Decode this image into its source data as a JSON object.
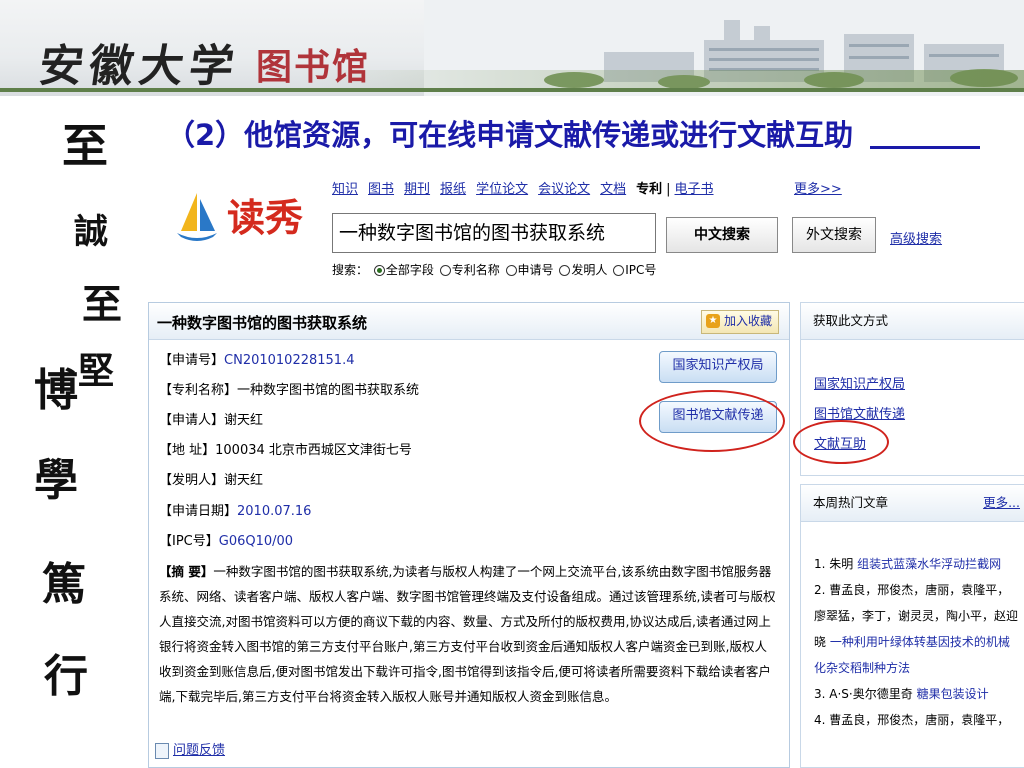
{
  "banner": {
    "calligraphy": "安徽大学",
    "library": "图书馆"
  },
  "motto": [
    "至",
    "誠",
    "至",
    "堅",
    "博",
    "學",
    "篤",
    "行"
  ],
  "slide_title": "（2）他馆资源，可在线申请文献传递或进行文献互助",
  "search": {
    "logo_text": "读秀",
    "nav": [
      "知识",
      "图书",
      "期刊",
      "报纸",
      "学位论文",
      "会议论文",
      "文档",
      "专利",
      "电子书",
      "更多>>"
    ],
    "current": "专利",
    "query": "一种数字图书馆的图书获取系统",
    "btn_cn": "中文搜索",
    "btn_foreign": "外文搜索",
    "advanced": "高级搜索",
    "options_label": "搜索：",
    "options": [
      "全部字段",
      "专利名称",
      "申请号",
      "发明人",
      "IPC号"
    ],
    "selected_option": "全部字段"
  },
  "record": {
    "title": "一种数字图书馆的图书获取系统",
    "fav": "加入收藏",
    "fields": [
      {
        "label": "【申请号】",
        "value": "CN201010228151.4"
      },
      {
        "label": "【专利名称】",
        "value": "一种数字图书馆的图书获取系统"
      },
      {
        "label": "【申请人】",
        "value": "谢天红"
      },
      {
        "label": "【地 址】",
        "value": "100034 北京市西城区文津街七号"
      },
      {
        "label": "【发明人】",
        "value": "谢天红"
      },
      {
        "label": "【申请日期】",
        "value": "2010.07.16"
      },
      {
        "label": "【IPC号】",
        "value": "G06Q10/00"
      }
    ],
    "abstract_label": "【摘 要】",
    "abstract": "一种数字图书馆的图书获取系统,为读者与版权人构建了一个网上交流平台,该系统由数字图书馆服务器系统、网络、读者客户端、版权人客户端、数字图书馆管理终端及支付设备组成。通过该管理系统,读者可与版权人直接交流,对图书馆资料可以方便的商议下载的内容、数量、方式及所付的版权费用,协议达成后,读者通过网上银行将资金转入图书馆的第三方支付平台账户,第三方支付平台收到资金后通知版权人客户端资金已到账,版权人收到资金到账信息后,便对图书馆发出下载许可指令,图书馆得到该指令后,便可将读者所需要资料下载给读者客户端,下载完毕后,第三方支付平台将资金转入版权人账号并通知版权人资金到账信息。",
    "btn_sipo": "国家知识产权局",
    "btn_delivery": "图书馆文献传递",
    "feedback": "问题反馈"
  },
  "acquire": {
    "head": "获取此文方式",
    "links": [
      "国家知识产权局",
      "图书馆文献传递",
      "文献互助"
    ]
  },
  "hot": {
    "head": "本周热门文章",
    "more": "更多...",
    "items": [
      {
        "num": "1.",
        "authors": "朱明",
        "title": "组装式蓝藻水华浮动拦截网"
      },
      {
        "num": "2.",
        "authors": "曹孟良，邢俊杰，唐丽，袁隆平，廖翠猛，李丁，谢灵灵，陶小平，赵迎晓",
        "title": "一种利用叶绿体转基因技术的机械化杂交稻制种方法"
      },
      {
        "num": "3.",
        "authors": "A·S·奥尔德里奇",
        "title": "糖果包装设计"
      },
      {
        "num": "4.",
        "authors": "曹孟良，邢俊杰，唐丽，袁隆平，",
        "title": ""
      }
    ]
  }
}
